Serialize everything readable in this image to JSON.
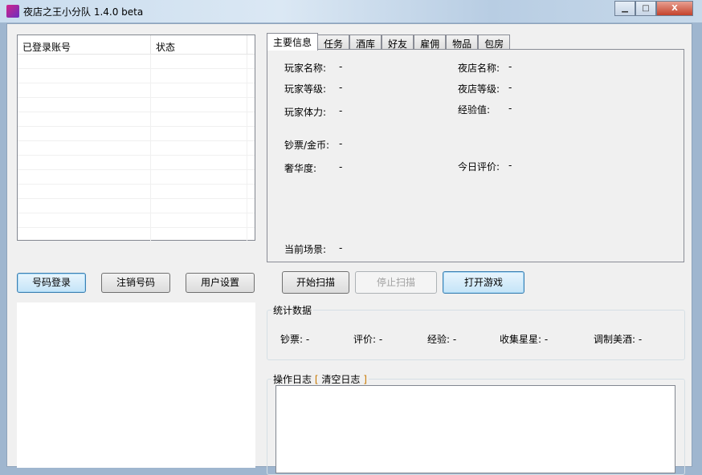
{
  "window": {
    "title": "夜店之王小分队 1.4.0 beta",
    "minimize": "▁",
    "maximize": "□",
    "close": "X"
  },
  "accounts": {
    "columns": [
      "已登录账号",
      "状态"
    ],
    "rows": []
  },
  "buttons": {
    "login": "号码登录",
    "logout": "注销号码",
    "settings": "用户设置",
    "start_scan": "开始扫描",
    "stop_scan": "停止扫描",
    "open_game": "打开游戏"
  },
  "tabs": [
    "主要信息",
    "任务",
    "酒库",
    "好友",
    "雇佣",
    "物品",
    "包房"
  ],
  "main_info": {
    "player_name": {
      "label": "玩家名称:",
      "value": "-"
    },
    "club_name": {
      "label": "夜店名称:",
      "value": "-"
    },
    "player_level": {
      "label": "玩家等级:",
      "value": "-"
    },
    "club_level": {
      "label": "夜店等级:",
      "value": "-"
    },
    "stamina": {
      "label": "玩家体力:",
      "value": "-"
    },
    "exp": {
      "label": "经验值:",
      "value": "-"
    },
    "money": {
      "label": "钞票/金币:",
      "value": "-"
    },
    "luxury": {
      "label": "奢华度:",
      "value": "-"
    },
    "rating": {
      "label": "今日评价:",
      "value": "-"
    },
    "scene": {
      "label": "当前场景:",
      "value": "-"
    }
  },
  "stats": {
    "title": "统计数据",
    "items": [
      {
        "label": "钞票:",
        "value": "-"
      },
      {
        "label": "评价:",
        "value": "-"
      },
      {
        "label": "经验:",
        "value": "-"
      },
      {
        "label": "收集星星:",
        "value": "-"
      },
      {
        "label": "调制美酒:",
        "value": "-"
      }
    ]
  },
  "log": {
    "title": "操作日志",
    "open_bracket": "[",
    "clear": "清空日志",
    "close_bracket": "]"
  }
}
